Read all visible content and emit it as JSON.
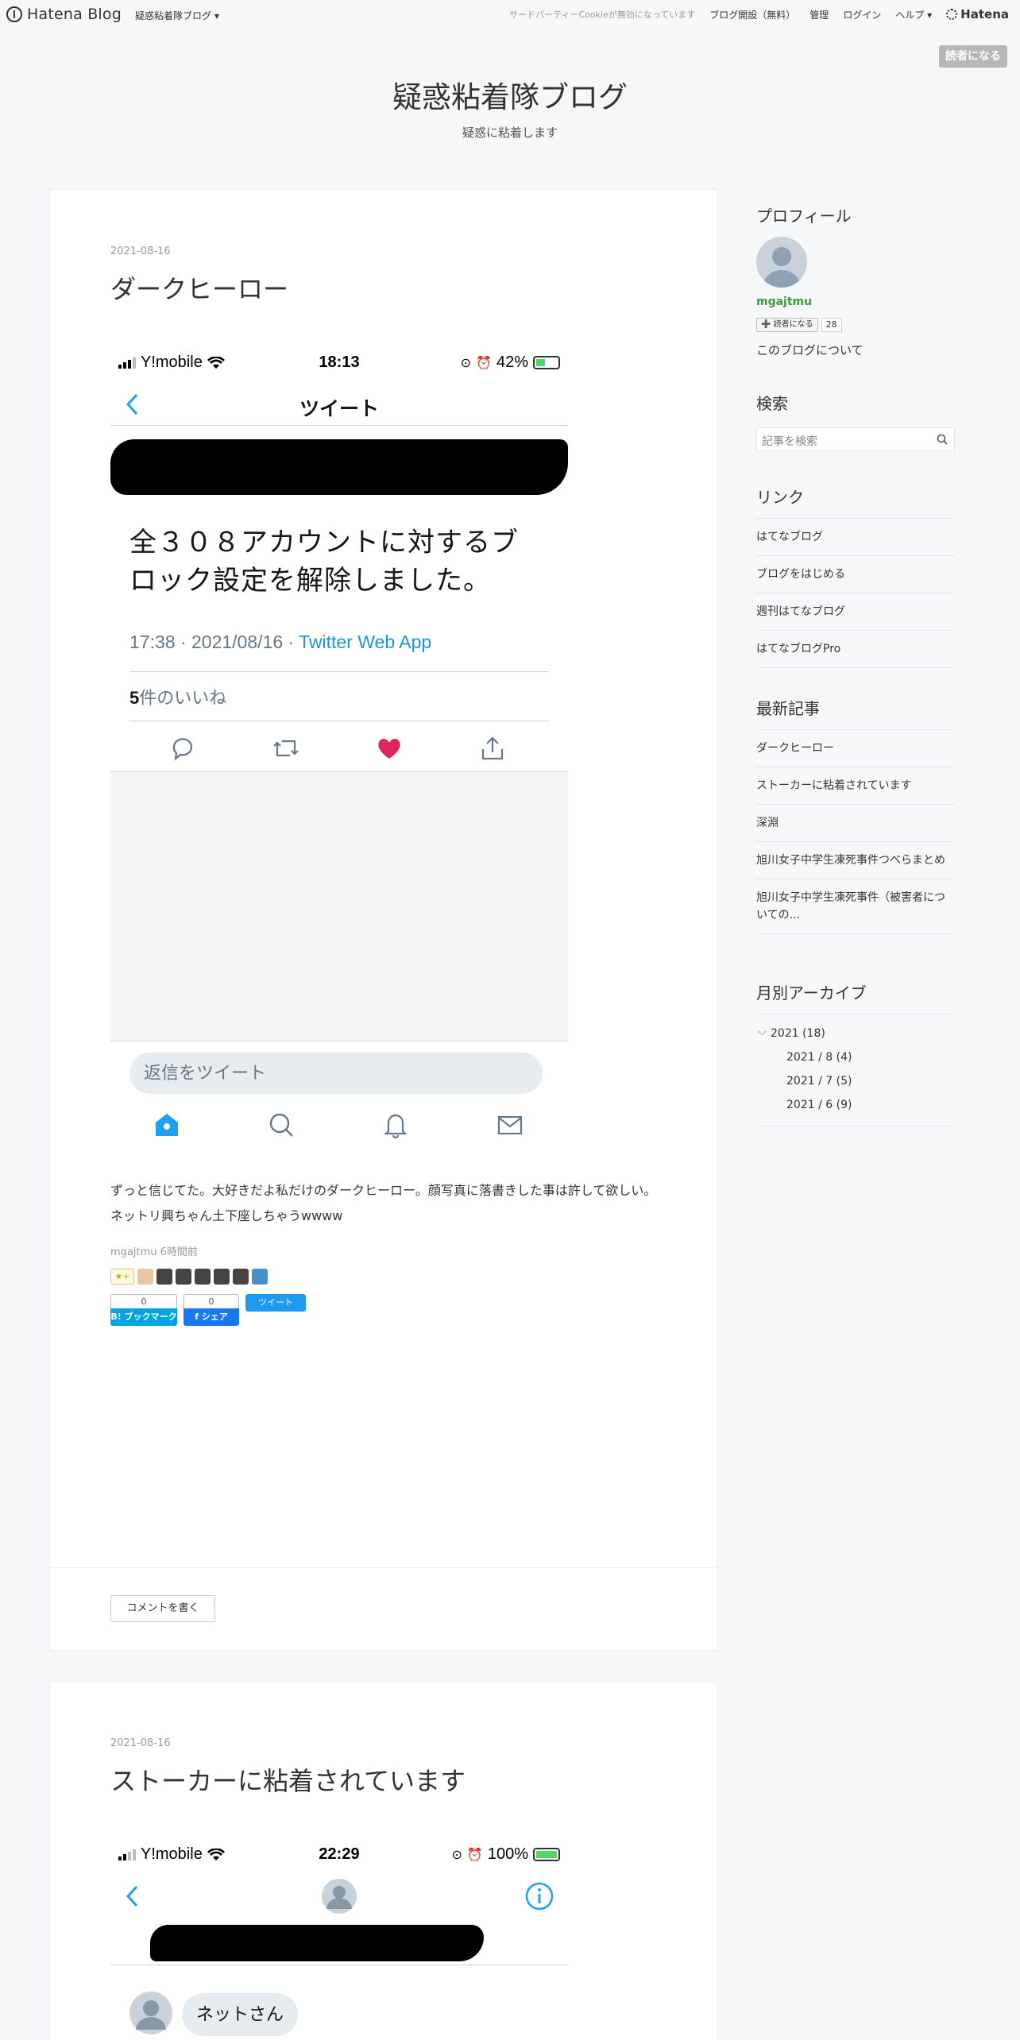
{
  "topbar": {
    "logo": "Hatena Blog",
    "blog_menu": "疑惑粘着隊ブログ ▾",
    "cookie_notice": "サードパーティーCookieが無効になっています",
    "open_blog": "ブログ開設（無料）",
    "admin": "管理",
    "login": "ログイン",
    "help": "ヘルプ ▾",
    "hatena": "Hatena"
  },
  "reader_button": "読者になる",
  "blog": {
    "title": "疑惑粘着隊ブログ",
    "description": "疑惑に粘着します"
  },
  "articles": [
    {
      "date": "2021-08-16",
      "title": "ダークヒーロー",
      "screenshot": {
        "carrier": "Y!mobile",
        "time": "18:13",
        "battery": "42%",
        "battery_level": 0.42,
        "header": "ツイート",
        "tweet_text": "全３０８アカウントに対するブロック設定を解除しました。",
        "meta_time": "17:38 · 2021/08/16 · ",
        "meta_source": "Twitter Web App",
        "likes_count": "5",
        "likes_label": "件のいいね",
        "reply_placeholder": "返信をツイート"
      },
      "body": "ずっと信じてた。大好きだよ私だけのダークヒーロー。顔写真に落書きした事は許して欲しい。ネットリ興ちゃん土下座しちゃうwwww",
      "author_line": "mgajtmu 6時間前",
      "star_add": "★+",
      "hatebu_count": "0",
      "hatebu_label": "B! ブックマーク",
      "fb_count": "0",
      "fb_label": "f シェア",
      "tweet_button": "ツイート",
      "comment_button": "コメントを書く"
    },
    {
      "date": "2021-08-16",
      "title": "ストーカーに粘着されています",
      "screenshot": {
        "carrier": "Y!mobile",
        "time": "22:29",
        "battery": "100%",
        "battery_level": 1.0,
        "bubble": "ネットさん"
      }
    }
  ],
  "sidebar": {
    "profile_heading": "プロフィール",
    "username": "mgajtmu",
    "subscribe_label": "➕ 読者になる",
    "subscribe_count": "28",
    "about": "このブログについて",
    "search_heading": "検索",
    "search_placeholder": "記事を検索",
    "links_heading": "リンク",
    "links": [
      "はてなブログ",
      "ブログをはじめる",
      "週刊はてなブログ",
      "はてなブログPro"
    ],
    "recent_heading": "最新記事",
    "recent": [
      "ダークヒーロー",
      "ストーカーに粘着されています",
      "深淵",
      "旭川女子中学生凍死事件つべらまとめ",
      "旭川女子中学生凍死事件（被害者についての..."
    ],
    "archive_heading": "月別アーカイブ",
    "archive_year": "2021 (18)",
    "archive_months": [
      "2021 / 8 (4)",
      "2021 / 7 (5)",
      "2021 / 6 (9)"
    ]
  }
}
